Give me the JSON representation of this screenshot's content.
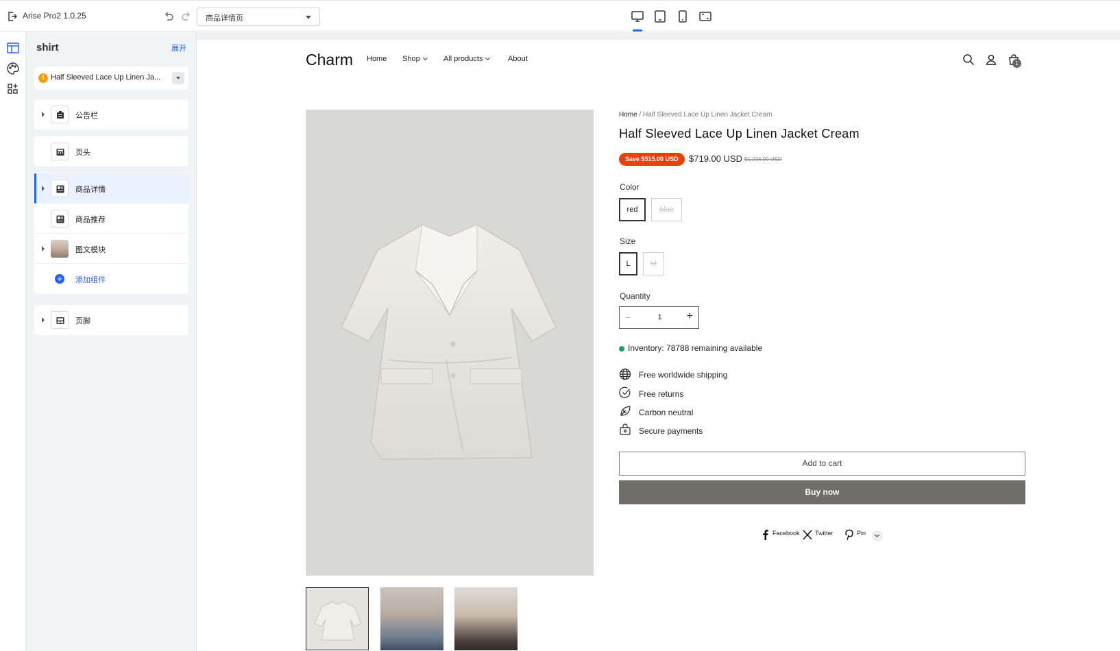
{
  "topbar": {
    "app_title": "Arise Pro2  1.0.25",
    "page_select": "商品详情页"
  },
  "panel": {
    "title": "shirt",
    "expand": "展开",
    "product_select": "Half Sleeved Lace Up Linen Ja...",
    "warn": "!",
    "sections": [
      {
        "label": "公告栏"
      },
      {
        "label": "页头"
      },
      {
        "label": "商品详情"
      },
      {
        "label": "商品推荐"
      },
      {
        "label": "图文模块"
      },
      {
        "label": "添加组件"
      },
      {
        "label": "页脚"
      }
    ]
  },
  "store": {
    "brand": "Charm",
    "nav": [
      "Home",
      "Shop",
      "All products",
      "About"
    ],
    "cart_count": "1"
  },
  "product": {
    "breadcrumb_home": "Home",
    "breadcrumb_sep": "/",
    "breadcrumb_current": "Half Sleeved Lace Up Linen Jacket Cream",
    "title": "Half Sleeved Lace Up Linen Jacket Cream",
    "save_badge": "Save $515.00 USD",
    "price": "$719.00 USD",
    "old_price": "$1,234.00 USD",
    "color_label": "Color",
    "colors": [
      "red",
      "blue"
    ],
    "size_label": "Size",
    "sizes": [
      "L",
      "M"
    ],
    "quantity_label": "Quantity",
    "quantity": "1",
    "inventory": "Inventory: 78788 remaining available",
    "features": [
      "Free worldwide shipping",
      "Free returns",
      "Carbon neutral",
      "Secure payments"
    ],
    "add_to_cart": "Add to cart",
    "buy_now": "Buy now",
    "share": [
      "Facebook",
      "Twitter",
      "Pin"
    ]
  },
  "colors": {
    "accent": "#2563eb",
    "save_badge": "#e8410f",
    "buy_button": "#716d68",
    "inventory_dot": "#22a06b",
    "warning": "#f59e0b"
  }
}
